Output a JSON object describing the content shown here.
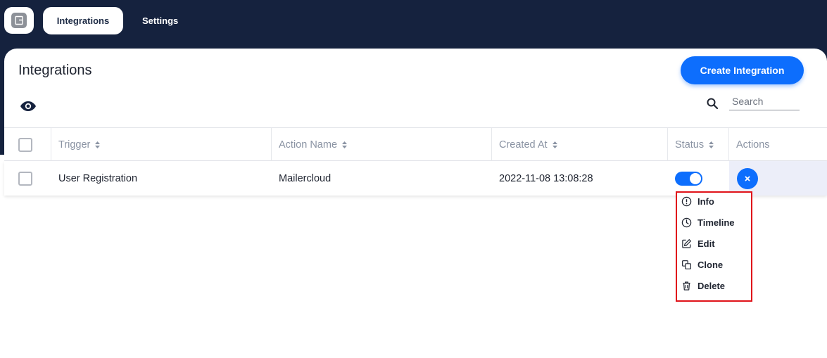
{
  "nav": {
    "logo_icon": "app-logo-icon",
    "tabs": [
      {
        "label": "Integrations",
        "active": true
      },
      {
        "label": "Settings",
        "active": false
      }
    ]
  },
  "page": {
    "title": "Integrations",
    "create_button": "Create Integration",
    "search_placeholder": "Search",
    "search_value": ""
  },
  "table": {
    "columns": [
      "Trigger",
      "Action Name",
      "Created At",
      "Status",
      "Actions"
    ],
    "rows": [
      {
        "trigger": "User Registration",
        "action_name": "Mailercloud",
        "created_at": "2022-11-08 13:08:28",
        "status_enabled": true
      }
    ]
  },
  "actions_menu": {
    "items": [
      {
        "label": "Info",
        "icon": "info-icon"
      },
      {
        "label": "Timeline",
        "icon": "clock-icon"
      },
      {
        "label": "Edit",
        "icon": "edit-icon"
      },
      {
        "label": "Clone",
        "icon": "clone-icon"
      },
      {
        "label": "Delete",
        "icon": "trash-icon"
      }
    ]
  },
  "colors": {
    "nav_bg": "#15223e",
    "primary": "#0d6efd",
    "highlight": "#e0131a",
    "actions_cell_bg": "#eceef9"
  }
}
